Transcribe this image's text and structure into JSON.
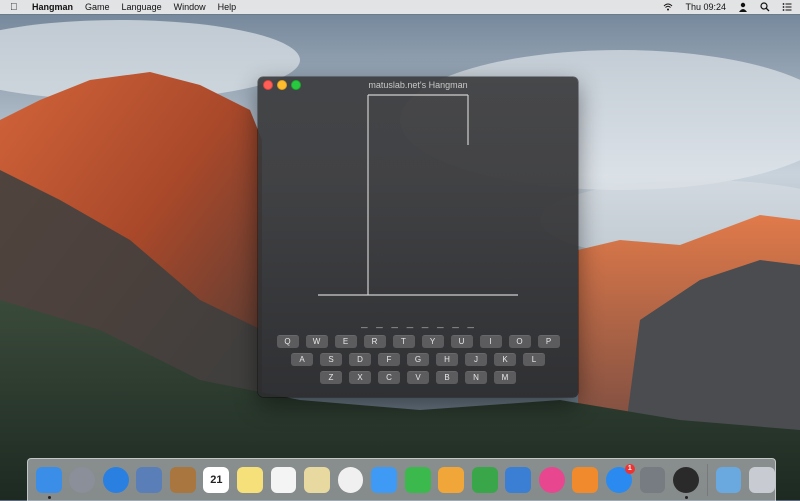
{
  "menubar": {
    "app_name": "Hangman",
    "menus": [
      "Game",
      "Language",
      "Window",
      "Help"
    ],
    "clock": "Thu 09:24"
  },
  "window": {
    "title": "matuslab.net's Hangman",
    "word_mask": "_ _ _ _ _ _ _ _",
    "keyboard": {
      "row1": [
        "Q",
        "W",
        "E",
        "R",
        "T",
        "Y",
        "U",
        "I",
        "O",
        "P"
      ],
      "row2": [
        "A",
        "S",
        "D",
        "F",
        "G",
        "H",
        "J",
        "K",
        "L"
      ],
      "row3": [
        "Z",
        "X",
        "C",
        "V",
        "B",
        "N",
        "M"
      ]
    }
  },
  "dock": {
    "items": [
      {
        "name": "finder-icon",
        "color": "#3b8ee8"
      },
      {
        "name": "launchpad-icon",
        "color": "#8a8f99"
      },
      {
        "name": "safari-icon",
        "color": "#2a80e0"
      },
      {
        "name": "mail-icon",
        "color": "#5a7fb8"
      },
      {
        "name": "contacts-icon",
        "color": "#a8763e"
      },
      {
        "name": "calendar-icon",
        "color": "#ffffff",
        "text": "21"
      },
      {
        "name": "notes-icon",
        "color": "#f5e07a"
      },
      {
        "name": "reminders-icon",
        "color": "#f4f4f4"
      },
      {
        "name": "preview-icon",
        "color": "#e8d9a0"
      },
      {
        "name": "photos-icon",
        "color": "#f0f0f0"
      },
      {
        "name": "messages-icon",
        "color": "#3f9af5"
      },
      {
        "name": "facetime-icon",
        "color": "#3cb94d"
      },
      {
        "name": "pages-icon",
        "color": "#f0a638"
      },
      {
        "name": "numbers-icon",
        "color": "#3aa64a"
      },
      {
        "name": "keynote-icon",
        "color": "#3a7fd4"
      },
      {
        "name": "itunes-icon",
        "color": "#e8468f"
      },
      {
        "name": "ibooks-icon",
        "color": "#f08a2c"
      },
      {
        "name": "app-store-icon",
        "color": "#2a8af0",
        "badge": "1"
      },
      {
        "name": "system-preferences-icon",
        "color": "#777b82"
      },
      {
        "name": "hangman-app-icon",
        "color": "#2a2a2a"
      }
    ],
    "trailing": [
      {
        "name": "downloads-folder-icon",
        "color": "#6aa8e0"
      },
      {
        "name": "trash-icon",
        "color": "#c8ccd2"
      }
    ]
  }
}
